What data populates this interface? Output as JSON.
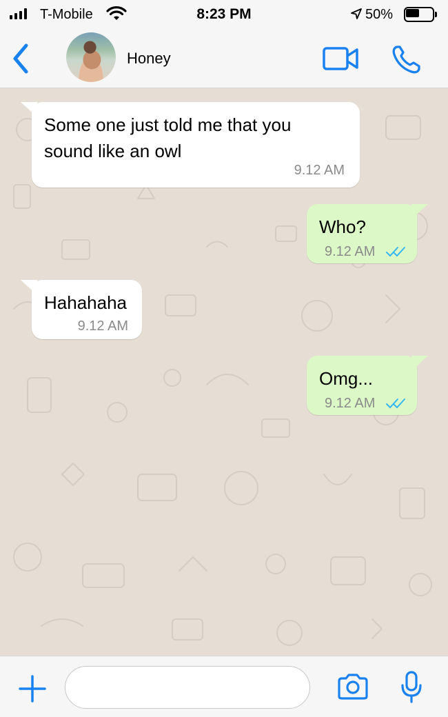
{
  "status_bar": {
    "carrier": "T-Mobile",
    "time": "8:23 PM",
    "battery_percent": "50%",
    "battery_level": 0.5,
    "icons": [
      "signal-bars-icon",
      "wifi-icon",
      "location-arrow-icon",
      "battery-icon"
    ]
  },
  "header": {
    "contact_name": "Honey",
    "icons": [
      "chevron-left-icon",
      "video-camera-icon",
      "phone-icon"
    ],
    "accent_color": "#1a82f0"
  },
  "messages": [
    {
      "direction": "incoming",
      "lines": [
        "Some one just told me that you",
        "sound like an owl"
      ],
      "time": "9.12 AM"
    },
    {
      "direction": "outgoing",
      "lines": [
        "Who?"
      ],
      "time": "9.12 AM",
      "status_icon": "double-check-icon"
    },
    {
      "direction": "incoming",
      "lines": [
        "Hahahaha"
      ],
      "time": "9.12 AM"
    },
    {
      "direction": "outgoing",
      "lines": [
        "Omg..."
      ],
      "time": "9.12 AM",
      "status_icon": "double-check-icon"
    }
  ],
  "colors": {
    "incoming_bubble": "#ffffff",
    "outgoing_bubble": "#dcf8c6",
    "chat_background": "#e6ddd4",
    "read_check": "#34b7f1"
  },
  "input_bar": {
    "message_value": "",
    "message_placeholder": "",
    "icons": [
      "plus-icon",
      "camera-icon",
      "microphone-icon"
    ]
  }
}
